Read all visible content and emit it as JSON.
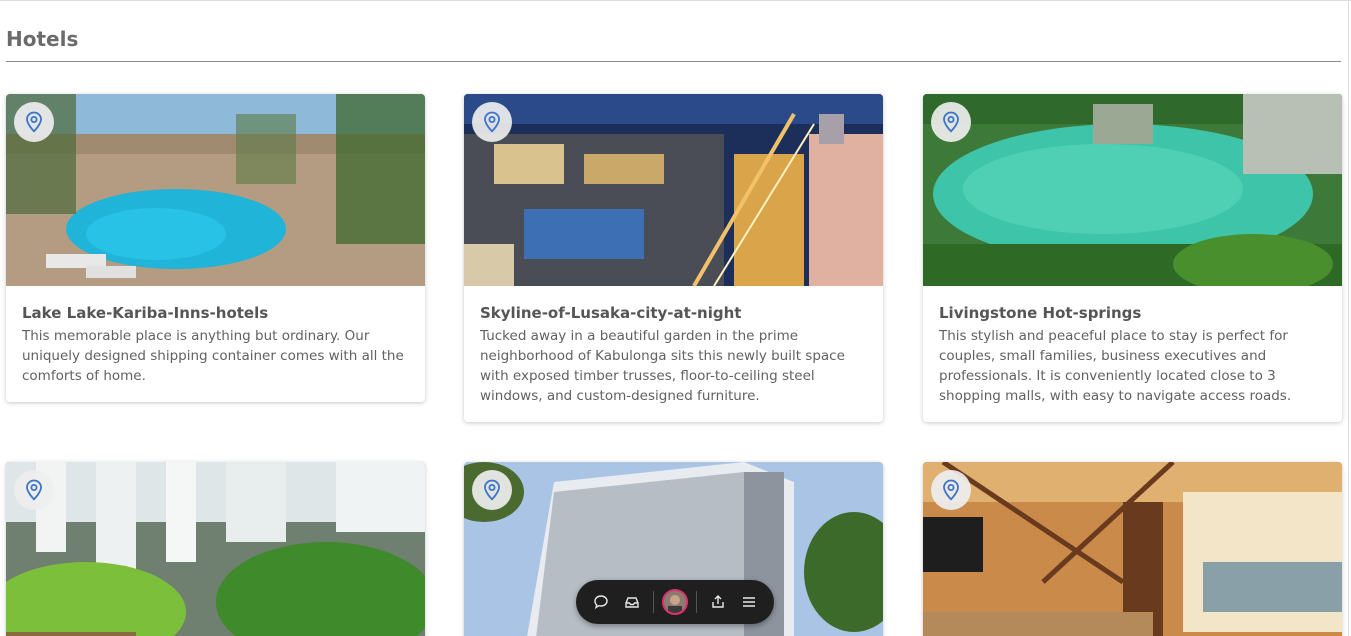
{
  "page": {
    "title": "Hotels"
  },
  "cards": [
    {
      "title": "Lake Lake-Kariba-Inns-hotels",
      "description": "This memorable place is anything but ordinary. Our uniquely designed shipping container comes with all the comforts of home.",
      "icon": "map-pin-icon"
    },
    {
      "title": "Skyline-of-Lusaka-city-at-night",
      "description": "Tucked away in a beautiful garden in the prime neighborhood of Kabulonga sits this newly built space with exposed timber trusses, floor-to-ceiling steel windows, and custom-designed furniture.",
      "icon": "map-pin-icon"
    },
    {
      "title": "Livingstone Hot-springs",
      "description": "This stylish and peaceful place to stay is perfect for couples, small families, business executives and professionals. It is conveniently located close to 3 shopping malls, with easy to navigate access roads.",
      "icon": "map-pin-icon"
    }
  ],
  "toolbar": {
    "icons": [
      "comment-icon",
      "inbox-icon",
      "avatar",
      "share-icon",
      "menu-icon"
    ]
  },
  "colors": {
    "pin": "#3b73c9",
    "toolbar_bg": "#1f1f1f",
    "title": "#6b6b6b"
  }
}
